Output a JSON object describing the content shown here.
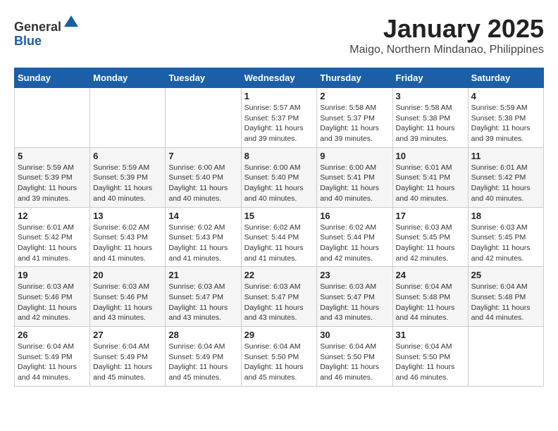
{
  "header": {
    "logo_line1": "General",
    "logo_line2": "Blue",
    "month": "January 2025",
    "location": "Maigo, Northern Mindanao, Philippines"
  },
  "weekdays": [
    "Sunday",
    "Monday",
    "Tuesday",
    "Wednesday",
    "Thursday",
    "Friday",
    "Saturday"
  ],
  "weeks": [
    [
      {
        "day": "",
        "sunrise": "",
        "sunset": "",
        "daylight": ""
      },
      {
        "day": "",
        "sunrise": "",
        "sunset": "",
        "daylight": ""
      },
      {
        "day": "",
        "sunrise": "",
        "sunset": "",
        "daylight": ""
      },
      {
        "day": "1",
        "sunrise": "Sunrise: 5:57 AM",
        "sunset": "Sunset: 5:37 PM",
        "daylight": "Daylight: 11 hours and 39 minutes."
      },
      {
        "day": "2",
        "sunrise": "Sunrise: 5:58 AM",
        "sunset": "Sunset: 5:37 PM",
        "daylight": "Daylight: 11 hours and 39 minutes."
      },
      {
        "day": "3",
        "sunrise": "Sunrise: 5:58 AM",
        "sunset": "Sunset: 5:38 PM",
        "daylight": "Daylight: 11 hours and 39 minutes."
      },
      {
        "day": "4",
        "sunrise": "Sunrise: 5:59 AM",
        "sunset": "Sunset: 5:38 PM",
        "daylight": "Daylight: 11 hours and 39 minutes."
      }
    ],
    [
      {
        "day": "5",
        "sunrise": "Sunrise: 5:59 AM",
        "sunset": "Sunset: 5:39 PM",
        "daylight": "Daylight: 11 hours and 39 minutes."
      },
      {
        "day": "6",
        "sunrise": "Sunrise: 5:59 AM",
        "sunset": "Sunset: 5:39 PM",
        "daylight": "Daylight: 11 hours and 40 minutes."
      },
      {
        "day": "7",
        "sunrise": "Sunrise: 6:00 AM",
        "sunset": "Sunset: 5:40 PM",
        "daylight": "Daylight: 11 hours and 40 minutes."
      },
      {
        "day": "8",
        "sunrise": "Sunrise: 6:00 AM",
        "sunset": "Sunset: 5:40 PM",
        "daylight": "Daylight: 11 hours and 40 minutes."
      },
      {
        "day": "9",
        "sunrise": "Sunrise: 6:00 AM",
        "sunset": "Sunset: 5:41 PM",
        "daylight": "Daylight: 11 hours and 40 minutes."
      },
      {
        "day": "10",
        "sunrise": "Sunrise: 6:01 AM",
        "sunset": "Sunset: 5:41 PM",
        "daylight": "Daylight: 11 hours and 40 minutes."
      },
      {
        "day": "11",
        "sunrise": "Sunrise: 6:01 AM",
        "sunset": "Sunset: 5:42 PM",
        "daylight": "Daylight: 11 hours and 40 minutes."
      }
    ],
    [
      {
        "day": "12",
        "sunrise": "Sunrise: 6:01 AM",
        "sunset": "Sunset: 5:42 PM",
        "daylight": "Daylight: 11 hours and 41 minutes."
      },
      {
        "day": "13",
        "sunrise": "Sunrise: 6:02 AM",
        "sunset": "Sunset: 5:43 PM",
        "daylight": "Daylight: 11 hours and 41 minutes."
      },
      {
        "day": "14",
        "sunrise": "Sunrise: 6:02 AM",
        "sunset": "Sunset: 5:43 PM",
        "daylight": "Daylight: 11 hours and 41 minutes."
      },
      {
        "day": "15",
        "sunrise": "Sunrise: 6:02 AM",
        "sunset": "Sunset: 5:44 PM",
        "daylight": "Daylight: 11 hours and 41 minutes."
      },
      {
        "day": "16",
        "sunrise": "Sunrise: 6:02 AM",
        "sunset": "Sunset: 5:44 PM",
        "daylight": "Daylight: 11 hours and 42 minutes."
      },
      {
        "day": "17",
        "sunrise": "Sunrise: 6:03 AM",
        "sunset": "Sunset: 5:45 PM",
        "daylight": "Daylight: 11 hours and 42 minutes."
      },
      {
        "day": "18",
        "sunrise": "Sunrise: 6:03 AM",
        "sunset": "Sunset: 5:45 PM",
        "daylight": "Daylight: 11 hours and 42 minutes."
      }
    ],
    [
      {
        "day": "19",
        "sunrise": "Sunrise: 6:03 AM",
        "sunset": "Sunset: 5:46 PM",
        "daylight": "Daylight: 11 hours and 42 minutes."
      },
      {
        "day": "20",
        "sunrise": "Sunrise: 6:03 AM",
        "sunset": "Sunset: 5:46 PM",
        "daylight": "Daylight: 11 hours and 43 minutes."
      },
      {
        "day": "21",
        "sunrise": "Sunrise: 6:03 AM",
        "sunset": "Sunset: 5:47 PM",
        "daylight": "Daylight: 11 hours and 43 minutes."
      },
      {
        "day": "22",
        "sunrise": "Sunrise: 6:03 AM",
        "sunset": "Sunset: 5:47 PM",
        "daylight": "Daylight: 11 hours and 43 minutes."
      },
      {
        "day": "23",
        "sunrise": "Sunrise: 6:03 AM",
        "sunset": "Sunset: 5:47 PM",
        "daylight": "Daylight: 11 hours and 43 minutes."
      },
      {
        "day": "24",
        "sunrise": "Sunrise: 6:04 AM",
        "sunset": "Sunset: 5:48 PM",
        "daylight": "Daylight: 11 hours and 44 minutes."
      },
      {
        "day": "25",
        "sunrise": "Sunrise: 6:04 AM",
        "sunset": "Sunset: 5:48 PM",
        "daylight": "Daylight: 11 hours and 44 minutes."
      }
    ],
    [
      {
        "day": "26",
        "sunrise": "Sunrise: 6:04 AM",
        "sunset": "Sunset: 5:49 PM",
        "daylight": "Daylight: 11 hours and 44 minutes."
      },
      {
        "day": "27",
        "sunrise": "Sunrise: 6:04 AM",
        "sunset": "Sunset: 5:49 PM",
        "daylight": "Daylight: 11 hours and 45 minutes."
      },
      {
        "day": "28",
        "sunrise": "Sunrise: 6:04 AM",
        "sunset": "Sunset: 5:49 PM",
        "daylight": "Daylight: 11 hours and 45 minutes."
      },
      {
        "day": "29",
        "sunrise": "Sunrise: 6:04 AM",
        "sunset": "Sunset: 5:50 PM",
        "daylight": "Daylight: 11 hours and 45 minutes."
      },
      {
        "day": "30",
        "sunrise": "Sunrise: 6:04 AM",
        "sunset": "Sunset: 5:50 PM",
        "daylight": "Daylight: 11 hours and 46 minutes."
      },
      {
        "day": "31",
        "sunrise": "Sunrise: 6:04 AM",
        "sunset": "Sunset: 5:50 PM",
        "daylight": "Daylight: 11 hours and 46 minutes."
      },
      {
        "day": "",
        "sunrise": "",
        "sunset": "",
        "daylight": ""
      }
    ]
  ]
}
